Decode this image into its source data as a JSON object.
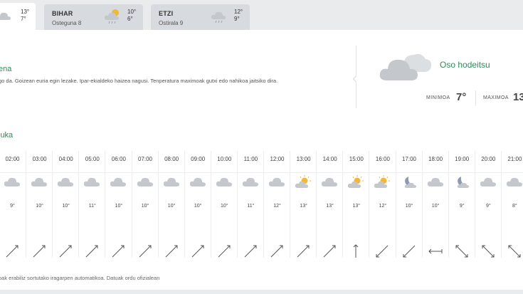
{
  "tabs": [
    {
      "day": "",
      "date": "",
      "max": "13°",
      "min": "7°",
      "icon": "cloud-icon"
    },
    {
      "day": "BIHAR",
      "date": "Osteguna 8",
      "max": "10°",
      "min": "6°",
      "icon": "partly-cloudy-rain-icon"
    },
    {
      "day": "ETZI",
      "date": "Ostirala 9",
      "max": "12°",
      "min": "9°",
      "icon": "cloud-rain-icon"
    }
  ],
  "summary": {
    "title": "ena",
    "text": "go da. Goizean euria egin lezake. Ipar-ekialdeko haizea nagusi. Tenperatura maximoak gutxi edo nahikoa jaitsiko dira.",
    "condition": "Oso hodeitsu",
    "condition_icon": "cloud-icon",
    "min_label": "MINIMOA",
    "min_value": "7°",
    "max_label": "MAXIMOA",
    "max_value": "13"
  },
  "hourly": {
    "title": "luka",
    "hours": [
      {
        "time": "02:00",
        "icon": "cloud-icon",
        "temp": "9°",
        "wind": "arrow-ne"
      },
      {
        "time": "03:00",
        "icon": "cloud-icon",
        "temp": "10°",
        "wind": "arrow-ne"
      },
      {
        "time": "04:00",
        "icon": "cloud-icon",
        "temp": "10°",
        "wind": "arrow-ne"
      },
      {
        "time": "05:00",
        "icon": "cloud-icon",
        "temp": "11°",
        "wind": "arrow-ne"
      },
      {
        "time": "06:00",
        "icon": "cloud-icon",
        "temp": "10°",
        "wind": "arrow-ne"
      },
      {
        "time": "07:00",
        "icon": "cloud-icon",
        "temp": "10°",
        "wind": "arrow-ne"
      },
      {
        "time": "08:00",
        "icon": "cloud-icon",
        "temp": "10°",
        "wind": "arrow-ne"
      },
      {
        "time": "09:00",
        "icon": "cloud-icon",
        "temp": "10°",
        "wind": "arrow-ne"
      },
      {
        "time": "10:00",
        "icon": "cloud-icon",
        "temp": "10°",
        "wind": "arrow-ne"
      },
      {
        "time": "11:00",
        "icon": "cloud-icon",
        "temp": "11°",
        "wind": "arrow-ne"
      },
      {
        "time": "12:00",
        "icon": "cloud-icon",
        "temp": "12°",
        "wind": "arrow-ne"
      },
      {
        "time": "13:00",
        "icon": "sun-cloud-icon",
        "temp": "13°",
        "wind": "arrow-ne"
      },
      {
        "time": "14:00",
        "icon": "cloud-icon",
        "temp": "13°",
        "wind": "arrow-ne"
      },
      {
        "time": "15:00",
        "icon": "sun-cloud-icon",
        "temp": "13°",
        "wind": "arrow-n"
      },
      {
        "time": "16:00",
        "icon": "sun-cloud-icon",
        "temp": "12°",
        "wind": "arrow-ne-bar"
      },
      {
        "time": "17:00",
        "icon": "moon-cloud-icon",
        "temp": "10°",
        "wind": "arrow-ne-bar"
      },
      {
        "time": "18:00",
        "icon": "cloud-icon",
        "temp": "10°",
        "wind": "arrow-w"
      },
      {
        "time": "19:00",
        "icon": "moon-cloud-icon",
        "temp": "9°",
        "wind": "arrow-se"
      },
      {
        "time": "20:00",
        "icon": "cloud-icon",
        "temp": "9°",
        "wind": "arrow-se"
      },
      {
        "time": "21:00",
        "icon": "cloud-icon",
        "temp": "8°",
        "wind": "arrow-se"
      }
    ]
  },
  "footnote": "oak erabiliz sortutako iragarpen automatikoa. Datuak ordu ofizialean",
  "colors": {
    "accent": "#2e8b57",
    "cloud": "#c4c7cb",
    "sun": "#f2b63a",
    "moon": "#8e9ab0"
  }
}
